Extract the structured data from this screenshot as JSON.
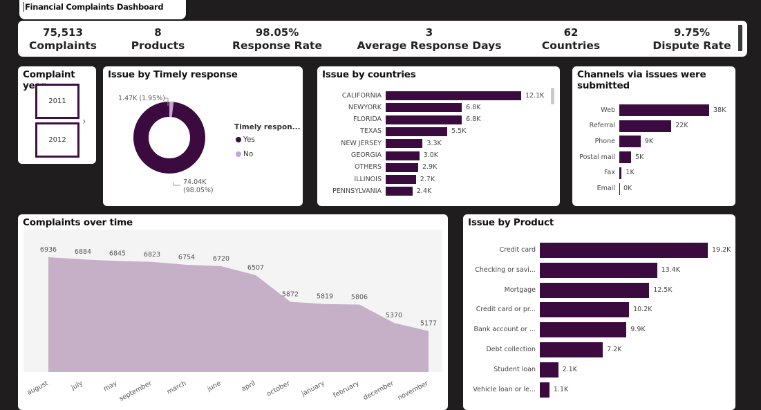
{
  "app_title": "Financial Complaints Dashboard",
  "kpis": [
    {
      "value": "75,513",
      "label": "Complaints"
    },
    {
      "value": "8",
      "label": "Products"
    },
    {
      "value": "98.05%",
      "label": "Response Rate"
    },
    {
      "value": "3",
      "label": "Average Response Days"
    },
    {
      "value": "62",
      "label": "Countries"
    },
    {
      "value": "9.75%",
      "label": "Dispute Rate"
    }
  ],
  "year_slicer": {
    "title": "Complaint year",
    "years": [
      "2011",
      "2012"
    ]
  },
  "timely": {
    "title": "Issue by Timely response",
    "legend_title": "Timely respon...",
    "legend": [
      {
        "name": "Yes",
        "color": "#3b0a3f"
      },
      {
        "name": "No",
        "color": "#c9a3d1"
      }
    ],
    "no_label": "1.47K (1.95%)",
    "yes_label_1": "74.04K",
    "yes_label_2": "(98.05%)"
  },
  "chart_data": [
    {
      "type": "pie",
      "title": "Issue by Timely response",
      "legend_title": "Timely respon...",
      "categories": [
        "Yes",
        "No"
      ],
      "values": [
        74040,
        1470
      ],
      "percentages": [
        98.05,
        1.95
      ]
    },
    {
      "type": "bar",
      "title": "Issue by countries",
      "categories": [
        "CALIFORNIA",
        "NEWYORK",
        "FLORIDA",
        "TEXAS",
        "NEW JERSEY",
        "GEORGIA",
        "OTHERS",
        "ILLINOIS",
        "PENNSYLVANIA"
      ],
      "values": [
        12100,
        6800,
        6800,
        5500,
        3300,
        3000,
        2900,
        2700,
        2400
      ],
      "labels": [
        "12.1K",
        "6.8K",
        "6.8K",
        "5.5K",
        "3.3K",
        "3.0K",
        "2.9K",
        "2.7K",
        "2.4K"
      ]
    },
    {
      "type": "bar",
      "title": "Channels via issues were submitted",
      "categories": [
        "Web",
        "Referral",
        "Phone",
        "Postal mail",
        "Fax",
        "Email"
      ],
      "values": [
        38000,
        22000,
        9000,
        5000,
        1000,
        0
      ],
      "labels": [
        "38K",
        "22K",
        "9K",
        "5K",
        "1K",
        "0K"
      ]
    },
    {
      "type": "area",
      "title": "Complaints over time",
      "categories": [
        "august",
        "july",
        "may",
        "september",
        "march",
        "june",
        "april",
        "october",
        "january",
        "february",
        "december",
        "november"
      ],
      "values": [
        6936,
        6884,
        6845,
        6823,
        6754,
        6720,
        6507,
        5872,
        5819,
        5806,
        5370,
        5177
      ],
      "ylim": [
        4200,
        7100
      ]
    },
    {
      "type": "bar",
      "title": "Issue by Product",
      "categories": [
        "Credit card",
        "Checking or savi...",
        "Mortgage",
        "Credit card or pr...",
        "Bank account or ...",
        "Debt collection",
        "Student loan",
        "Vehicle loan or le..."
      ],
      "values": [
        19200,
        13400,
        12500,
        10200,
        9900,
        7200,
        2100,
        1100
      ],
      "labels": [
        "19.2K",
        "13.4K",
        "12.5K",
        "10.2K",
        "9.9K",
        "7.2K",
        "2.1K",
        "1.1K"
      ]
    }
  ],
  "countries_title": "Issue by countries",
  "channels_title_1": "Channels via issues were",
  "channels_title_2": "submitted",
  "time_title": "Complaints over time",
  "product_title": "Issue by Product",
  "colors": {
    "bar": "#3b0a3f",
    "area": "#c5b0c7",
    "no_slice": "#c9a3d1",
    "background": "#1f1d1e"
  }
}
